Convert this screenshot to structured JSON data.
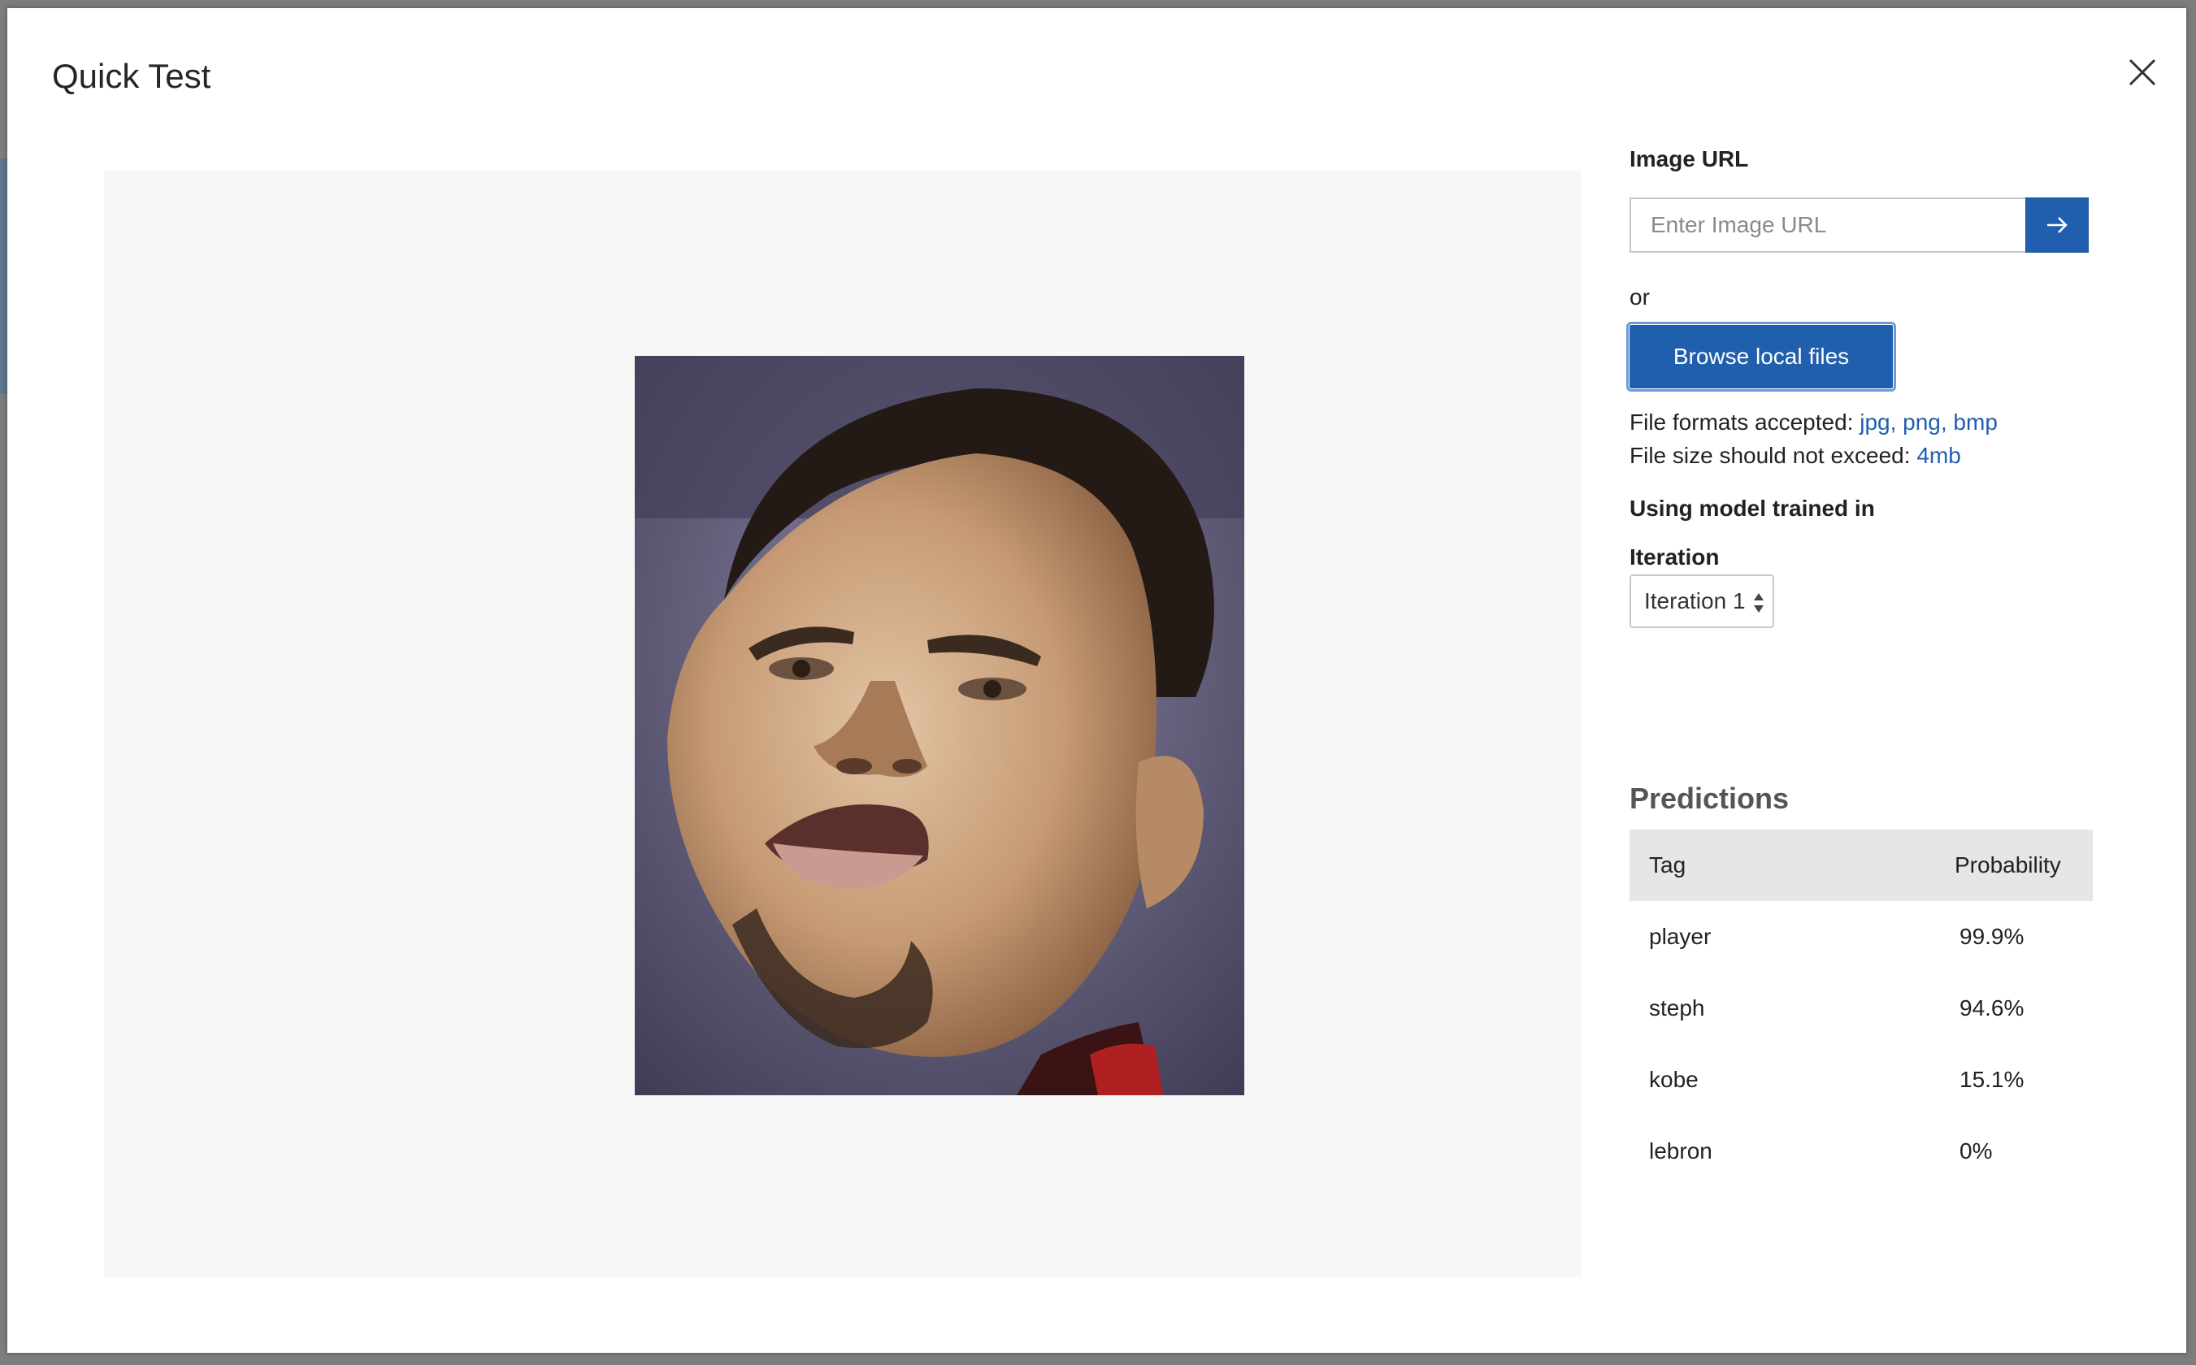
{
  "modal": {
    "title": "Quick Test"
  },
  "image_url": {
    "label": "Image URL",
    "placeholder": "Enter Image URL",
    "value": ""
  },
  "or_text": "or",
  "browse_button": "Browse local files",
  "file_info": {
    "formats_prefix": "File formats accepted: ",
    "formats": "jpg, png, bmp",
    "size_prefix": "File size should not exceed: ",
    "size": "4mb"
  },
  "model": {
    "label": "Using model trained in",
    "iteration_label": "Iteration",
    "iteration_value": "Iteration 1"
  },
  "predictions": {
    "title": "Predictions",
    "columns": [
      "Tag",
      "Probability"
    ],
    "rows": [
      {
        "tag": "player",
        "probability": "99.9%"
      },
      {
        "tag": "steph",
        "probability": "94.6%"
      },
      {
        "tag": "kobe",
        "probability": "15.1%"
      },
      {
        "tag": "lebron",
        "probability": "0%"
      }
    ]
  },
  "colors": {
    "accent": "#1f5fad",
    "table_header_bg": "#e6e6e6",
    "preview_bg": "#f7f7f7"
  },
  "icons": {
    "close": "close-icon",
    "submit_url": "arrow-right-icon",
    "select": "updown-chevron-icon"
  }
}
